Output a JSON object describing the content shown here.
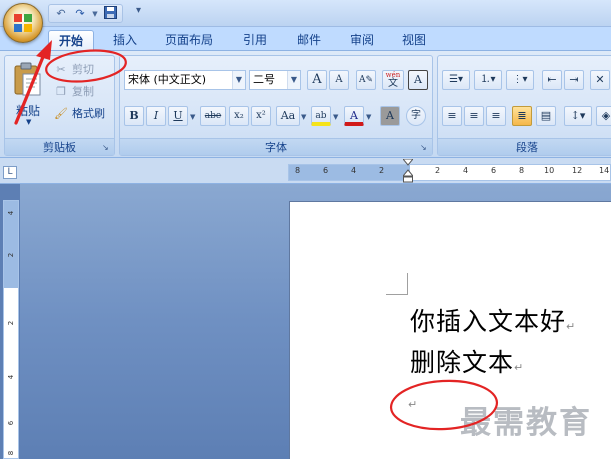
{
  "quick_access": {
    "undo_icon": "undo-icon",
    "redo_icon": "redo-icon",
    "save_icon": "save-icon"
  },
  "tabs": [
    {
      "label": "开始",
      "active": true
    },
    {
      "label": "插入"
    },
    {
      "label": "页面布局"
    },
    {
      "label": "引用"
    },
    {
      "label": "邮件"
    },
    {
      "label": "审阅"
    },
    {
      "label": "视图"
    }
  ],
  "clipboard": {
    "group_label": "剪贴板",
    "paste_label": "粘贴",
    "cut_label": "剪切",
    "copy_label": "复制",
    "format_painter_label": "格式刷"
  },
  "font": {
    "group_label": "字体",
    "font_name": "宋体 (中文正文)",
    "font_size": "二号",
    "grow_label": "A",
    "shrink_label": "A",
    "phonetic_label": "wén",
    "phonetic_char": "文",
    "border_label": "A",
    "bold_label": "B",
    "italic_label": "I",
    "underline_label": "U",
    "strike_label": "abe",
    "subscript_label": "x₂",
    "superscript_label": "x²",
    "case_label": "Aa",
    "highlight_label": "ab",
    "color_label": "A",
    "shade_label": "A",
    "enclose_label": "字"
  },
  "paragraph": {
    "group_label": "段落"
  },
  "ruler": {
    "h_ticks": [
      "8",
      "6",
      "4",
      "2",
      "2",
      "4",
      "6",
      "8",
      "10",
      "12",
      "14"
    ],
    "v_ticks": [
      "4",
      "2",
      "2",
      "4",
      "6",
      "8"
    ]
  },
  "document": {
    "line1": "你插入文本好",
    "line2": "删除文本",
    "para_mark": "↵"
  },
  "watermark": "最需教育",
  "colors": {
    "annotation_red": "#e32424",
    "ribbon_blue": "#15428b"
  }
}
